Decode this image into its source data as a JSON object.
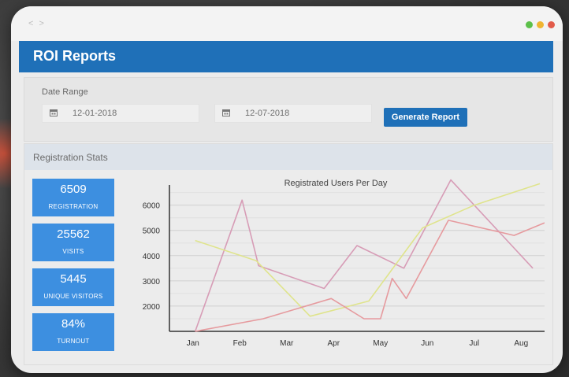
{
  "window": {
    "nav_arrows": "< >"
  },
  "header": {
    "title": "ROI Reports"
  },
  "filters": {
    "date_range_label": "Date Range",
    "start_date": "12-01-2018",
    "end_date": "12-07-2018",
    "generate_button": "Generate Report"
  },
  "stats": {
    "section_title": "Registration Stats",
    "cards": [
      {
        "value": "6509",
        "label": "REGISTRATION"
      },
      {
        "value": "25562",
        "label": "VISITS"
      },
      {
        "value": "5445",
        "label": "UNIQUE VISITORS"
      },
      {
        "value": "84%",
        "label": "TURNOUT"
      }
    ]
  },
  "colors": {
    "accent": "#1f70b8",
    "card": "#3d8fe0",
    "dot_green": "#5cc04a",
    "dot_yellow": "#f0b531",
    "dot_red": "#e25b4a"
  },
  "chart_data": {
    "type": "line",
    "title": "Registrated Users Per Day",
    "xlabel": "",
    "ylabel": "",
    "x_tick_labels": [
      "Jan",
      "Feb",
      "Mar",
      "Apr",
      "May",
      "Jun",
      "Jul",
      "Aug"
    ],
    "y_tick_labels": [
      "6000",
      "5000",
      "4000",
      "3000",
      "2000"
    ],
    "ylim": [
      1000,
      6800
    ],
    "grid": true,
    "series": [
      {
        "color": "#d79cb6",
        "points": [
          [
            0.55,
            1000
          ],
          [
            1.55,
            6200
          ],
          [
            1.9,
            3600
          ],
          [
            3.3,
            2700
          ],
          [
            4.0,
            4400
          ],
          [
            5.0,
            3500
          ],
          [
            6.0,
            7000
          ],
          [
            7.75,
            3500
          ]
        ]
      },
      {
        "color": "#dfe48c",
        "points": [
          [
            0.55,
            4600
          ],
          [
            1.85,
            3800
          ],
          [
            3.0,
            1600
          ],
          [
            4.25,
            2200
          ],
          [
            5.4,
            5100
          ],
          [
            6.5,
            6000
          ],
          [
            7.9,
            6850
          ]
        ]
      },
      {
        "color": "#e69a9e",
        "points": [
          [
            0.55,
            1000
          ],
          [
            2.0,
            1500
          ],
          [
            3.45,
            2300
          ],
          [
            4.15,
            1500
          ],
          [
            4.5,
            1500
          ],
          [
            4.75,
            3100
          ],
          [
            5.05,
            2300
          ],
          [
            5.95,
            5400
          ],
          [
            7.35,
            4800
          ],
          [
            8.0,
            5300
          ]
        ]
      }
    ]
  }
}
